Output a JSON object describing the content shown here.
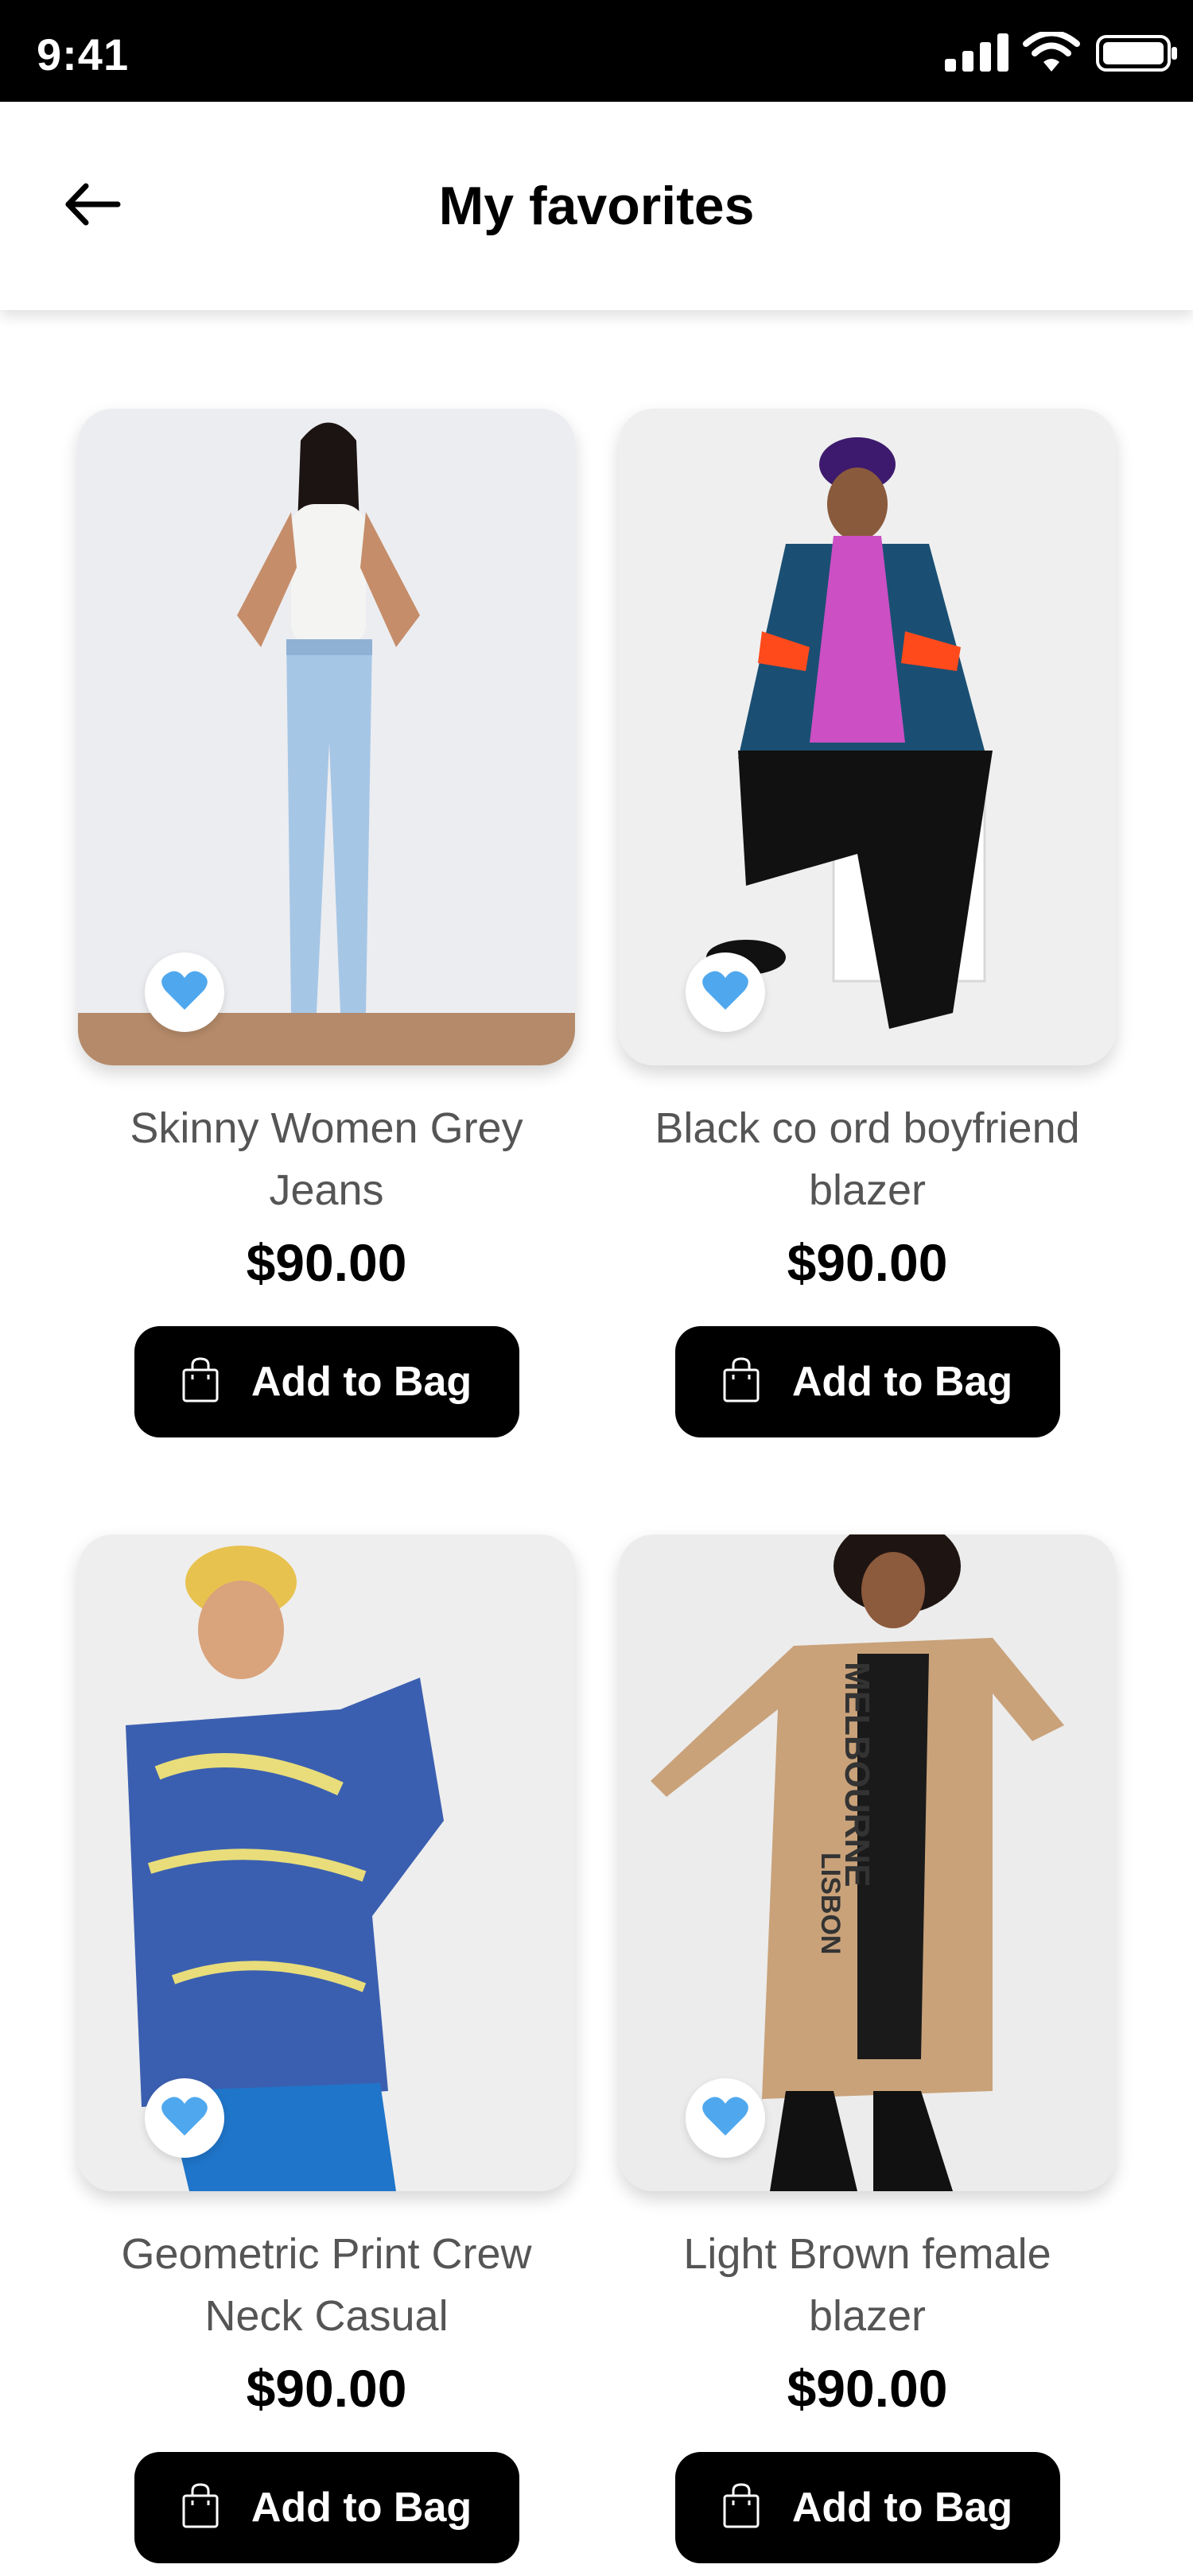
{
  "status_bar": {
    "time": "9:41",
    "icons": [
      "signal-icon",
      "wifi-icon",
      "battery-icon"
    ]
  },
  "header": {
    "title": "My favorites",
    "back_icon": "arrow-left-icon"
  },
  "colors": {
    "accent_heart": "#4FA8EE",
    "button_bg": "#000000",
    "button_text": "#FFFFFF",
    "price_text": "#000000",
    "title_text": "#555555"
  },
  "products": [
    {
      "title": "Skinny Women Grey Jeans",
      "price": "$90.00",
      "button_label": "Add to Bag",
      "favorite": true
    },
    {
      "title": "Black co ord boyfriend blazer",
      "price": "$90.00",
      "button_label": "Add to Bag",
      "favorite": true
    },
    {
      "title": "Geometric Print Crew Neck Casual",
      "price": "$90.00",
      "button_label": "Add to Bag",
      "favorite": true
    },
    {
      "title": "Light Brown female blazer",
      "price": "$90.00",
      "button_label": "Add to Bag",
      "favorite": true
    }
  ]
}
